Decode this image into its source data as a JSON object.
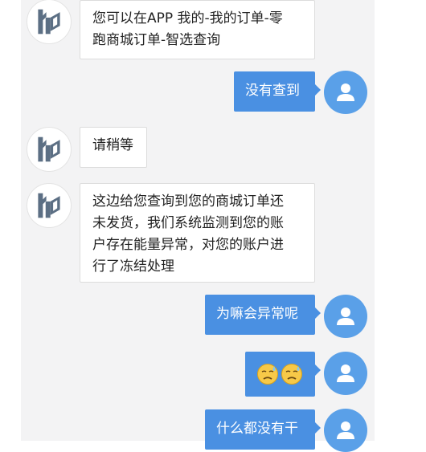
{
  "messages": [
    {
      "side": "left",
      "text": "您可以在APP 我的-我的订单-零\n跑商城订单-智选查询"
    },
    {
      "side": "right",
      "text": "没有查到"
    },
    {
      "side": "left",
      "text": "请稍等"
    },
    {
      "side": "left",
      "text": "这边给您查询到您的商城订单还\n未发货，我们系统监测到您的账\n户存在能量异常，对您的账户进\n行了冻结处理"
    },
    {
      "side": "right",
      "text": "为嘛会异常呢"
    },
    {
      "side": "right",
      "emoji": [
        "downcast-face-with-sweat",
        "downcast-face-with-sweat"
      ]
    },
    {
      "side": "right",
      "text": "什么都没有干"
    }
  ],
  "colors": {
    "self_bubble": "#4a90e2",
    "self_avatar": "#5aa0e8",
    "panel_bg": "#f3f3f4",
    "logo": "#5c6f84"
  },
  "icons": {
    "agent_avatar": "lp-logo-icon",
    "user_avatar": "user-silhouette-icon"
  }
}
